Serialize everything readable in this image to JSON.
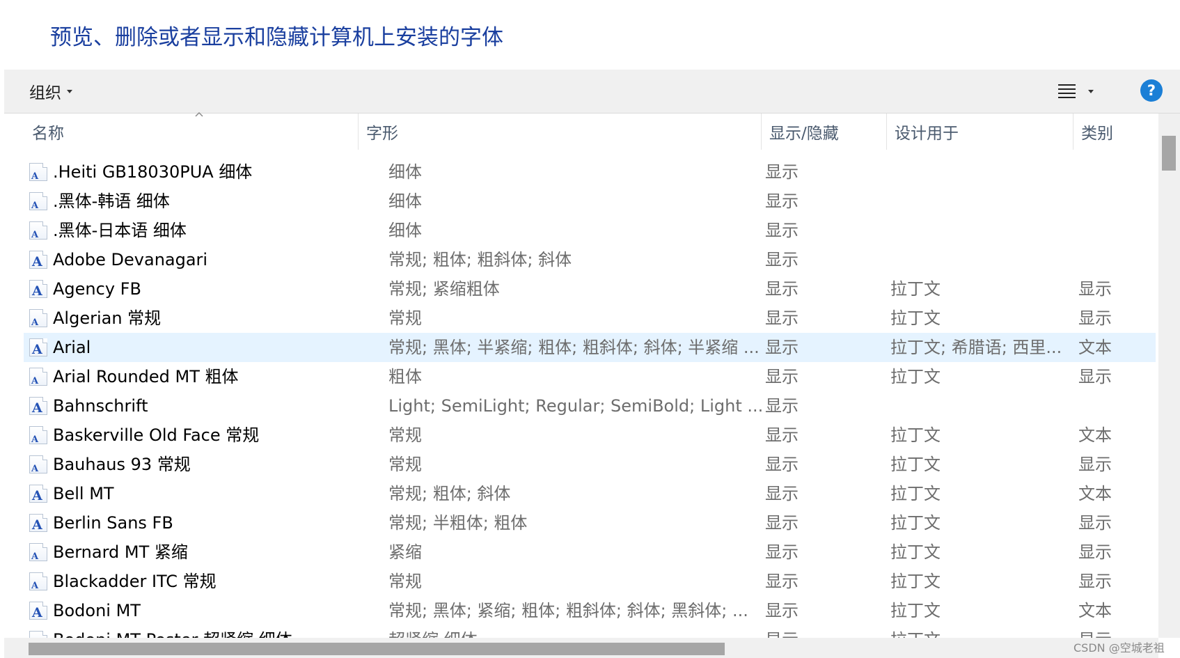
{
  "page": {
    "title": "预览、删除或者显示和隐藏计算机上安装的字体"
  },
  "toolbar": {
    "organize_label": "组织",
    "view_icon": "list-view-icon",
    "help_icon": "question-icon",
    "help_label": "?"
  },
  "columns": {
    "name": "名称",
    "style": "字形",
    "show_hide": "显示/隐藏",
    "designed_for": "设计用于",
    "category": "类别"
  },
  "fonts": [
    {
      "name": ".Heiti GB18030PUA 细体",
      "style": "细体",
      "show": "显示",
      "design": "",
      "category": "",
      "icon": "ttf"
    },
    {
      "name": ".黑体-韩语 细体",
      "style": "细体",
      "show": "显示",
      "design": "",
      "category": "",
      "icon": "ttf"
    },
    {
      "name": ".黑体-日本语 细体",
      "style": "细体",
      "show": "显示",
      "design": "",
      "category": "",
      "icon": "ttf"
    },
    {
      "name": "Adobe Devanagari",
      "style": "常规; 粗体; 粗斜体; 斜体",
      "show": "显示",
      "design": "",
      "category": "",
      "icon": "otf"
    },
    {
      "name": "Agency FB",
      "style": "常规; 紧缩粗体",
      "show": "显示",
      "design": "拉丁文",
      "category": "显示",
      "icon": "otf"
    },
    {
      "name": "Algerian 常规",
      "style": "常规",
      "show": "显示",
      "design": "拉丁文",
      "category": "显示",
      "icon": "ttf"
    },
    {
      "name": "Arial",
      "style": "常规; 黑体; 半紧缩; 粗体; 粗斜体; 斜体; 半紧缩 ...",
      "show": "显示",
      "design": "拉丁文; 希腊语; 西里...",
      "category": "文本",
      "icon": "otf",
      "selected": true
    },
    {
      "name": "Arial Rounded MT 粗体",
      "style": "粗体",
      "show": "显示",
      "design": "拉丁文",
      "category": "显示",
      "icon": "ttf"
    },
    {
      "name": "Bahnschrift",
      "style": "Light; SemiLight; Regular; SemiBold; Light ...",
      "show": "显示",
      "design": "",
      "category": "",
      "icon": "otf"
    },
    {
      "name": "Baskerville Old Face 常规",
      "style": "常规",
      "show": "显示",
      "design": "拉丁文",
      "category": "文本",
      "icon": "ttf"
    },
    {
      "name": "Bauhaus 93 常规",
      "style": "常规",
      "show": "显示",
      "design": "拉丁文",
      "category": "显示",
      "icon": "ttf"
    },
    {
      "name": "Bell MT",
      "style": "常规; 粗体; 斜体",
      "show": "显示",
      "design": "拉丁文",
      "category": "文本",
      "icon": "otf"
    },
    {
      "name": "Berlin Sans FB",
      "style": "常规; 半粗体; 粗体",
      "show": "显示",
      "design": "拉丁文",
      "category": "显示",
      "icon": "otf"
    },
    {
      "name": "Bernard MT 紧缩",
      "style": "紧缩",
      "show": "显示",
      "design": "拉丁文",
      "category": "显示",
      "icon": "ttf"
    },
    {
      "name": "Blackadder ITC 常规",
      "style": "常规",
      "show": "显示",
      "design": "拉丁文",
      "category": "显示",
      "icon": "ttf"
    },
    {
      "name": "Bodoni MT",
      "style": "常规; 黑体; 紧缩; 粗体; 粗斜体; 斜体; 黑斜体; ...",
      "show": "显示",
      "design": "拉丁文",
      "category": "文本",
      "icon": "otf"
    },
    {
      "name": "Bodoni MT Poster 超紧缩 细体",
      "style": "超紧缩 细体",
      "show": "显示",
      "design": "拉丁文",
      "category": "显示",
      "icon": "ttf"
    }
  ],
  "watermark": "CSDN @空城老祖"
}
